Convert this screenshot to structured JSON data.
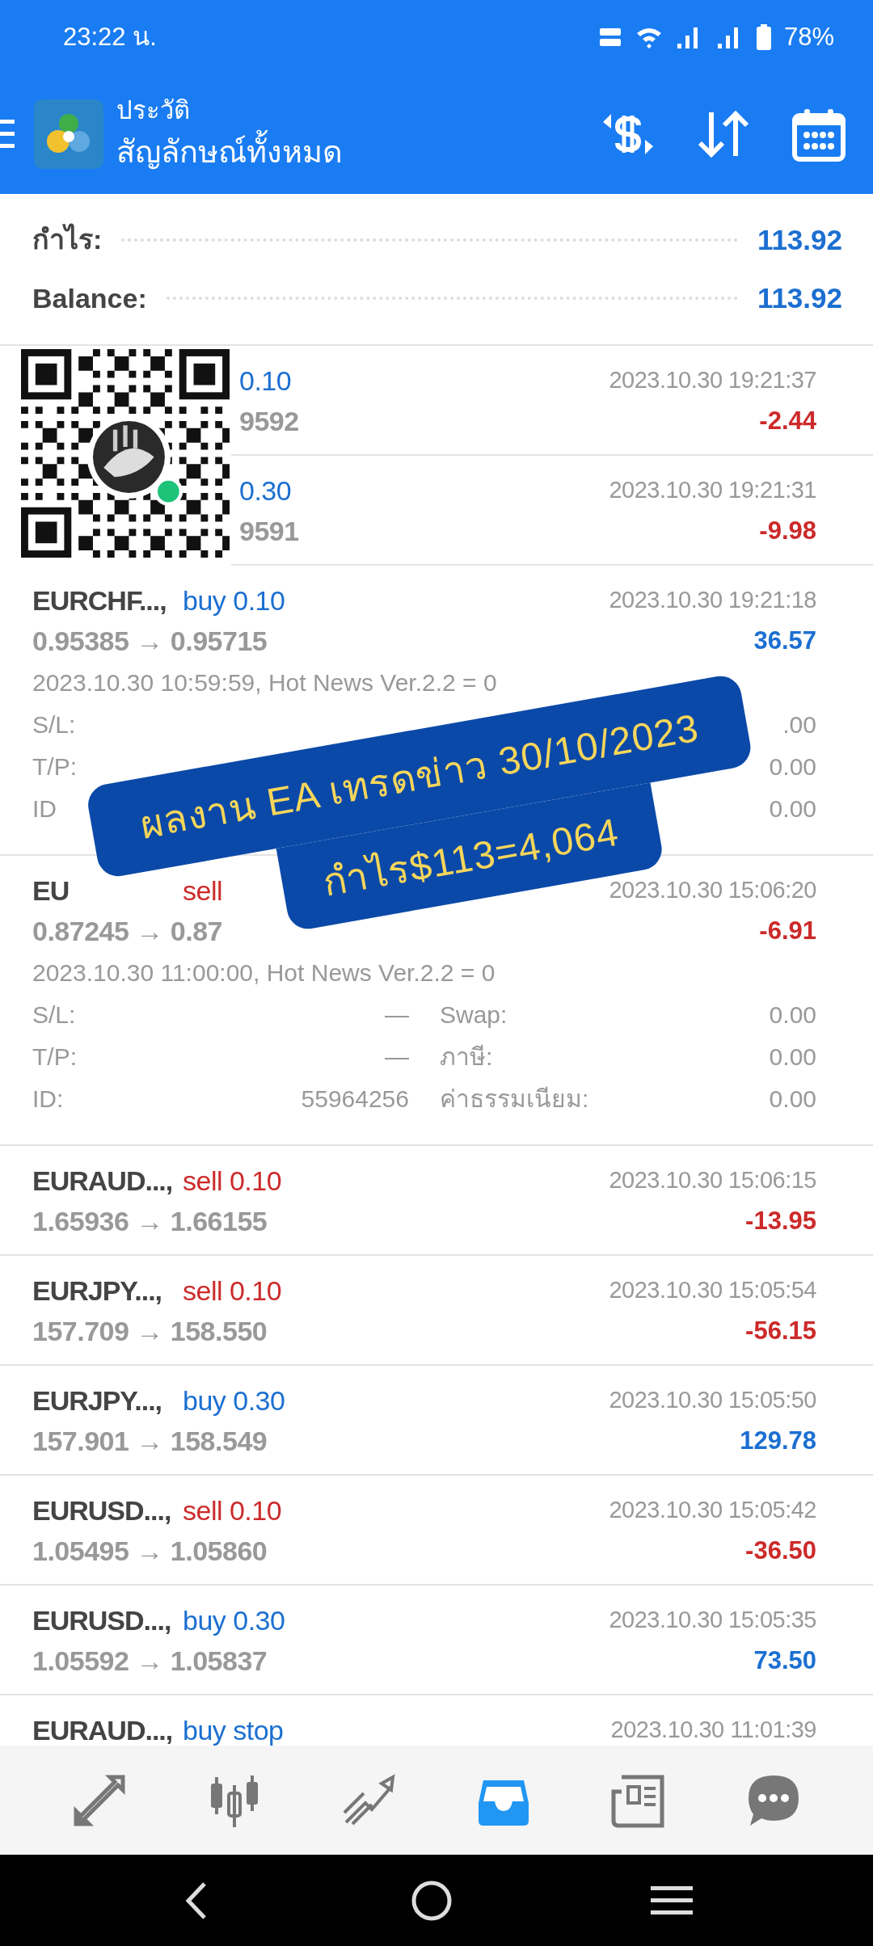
{
  "status_bar": {
    "time": "23:22 น.",
    "battery": "78%"
  },
  "header": {
    "title": "ประวัติ",
    "subtitle": "สัญลักษณ์ทั้งหมด"
  },
  "summary": [
    {
      "label": "กำไร:",
      "value": "113.92"
    },
    {
      "label": "Balance:",
      "value": "113.92"
    }
  ],
  "overlay_rows": [
    {
      "order": "0.10",
      "sell": false,
      "prices": "9592",
      "time": "2023.10.30 19:21:37",
      "profit": "-2.44",
      "loss": true
    },
    {
      "order": "0.30",
      "sell": false,
      "prices": "9591",
      "time": "2023.10.30 19:21:31",
      "profit": "-9.98",
      "loss": true
    }
  ],
  "trades": [
    {
      "symbol": "EURCHF...,",
      "order": "buy 0.10",
      "sell": false,
      "prices": "0.95385 → 0.95715",
      "time": "2023.10.30 19:21:18",
      "profit": "36.57",
      "loss": false,
      "details": {
        "comment": "2023.10.30 10:59:59, Hot News Ver.2.2 = 0",
        "lines": [
          {
            "label": "S/L:",
            "right_value": ".00"
          },
          {
            "label": "T/P:",
            "right_value": "0.00"
          },
          {
            "label": "ID",
            "right_value": "0.00"
          }
        ]
      }
    },
    {
      "symbol": "EU",
      "order": "sell",
      "sell": true,
      "prices": "0.87245 → 0.87",
      "time": "2023.10.30 15:06:20",
      "profit": "-6.91",
      "loss": true,
      "details": {
        "comment": "2023.10.30 11:00:00, Hot News Ver.2.2 = 0",
        "lines": [
          {
            "label": "S/L:",
            "value": "—",
            "right_label": "Swap:",
            "right_value": "0.00"
          },
          {
            "label": "T/P:",
            "value": "—",
            "right_label": "ภาษี:",
            "right_value": "0.00"
          },
          {
            "label": "ID:",
            "value": "55964256",
            "right_label": "ค่าธรรมเนียม:",
            "right_value": "0.00"
          }
        ]
      }
    },
    {
      "symbol": "EURAUD...,",
      "order": "sell 0.10",
      "sell": true,
      "prices": "1.65936 → 1.66155",
      "time": "2023.10.30 15:06:15",
      "profit": "-13.95",
      "loss": true
    },
    {
      "symbol": "EURJPY...,",
      "order": "sell 0.10",
      "sell": true,
      "prices": "157.709 → 158.550",
      "time": "2023.10.30 15:05:54",
      "profit": "-56.15",
      "loss": true
    },
    {
      "symbol": "EURJPY...,",
      "order": "buy 0.30",
      "sell": false,
      "prices": "157.901 → 158.549",
      "time": "2023.10.30 15:05:50",
      "profit": "129.78",
      "loss": false
    },
    {
      "symbol": "EURUSD...,",
      "order": "sell 0.10",
      "sell": true,
      "prices": "1.05495 → 1.05860",
      "time": "2023.10.30 15:05:42",
      "profit": "-36.50",
      "loss": true
    },
    {
      "symbol": "EURUSD...,",
      "order": "buy 0.30",
      "sell": false,
      "prices": "1.05592 → 1.05837",
      "time": "2023.10.30 15:05:35",
      "profit": "73.50",
      "loss": false
    },
    {
      "symbol": "EURAUD...,",
      "order": "buy stop",
      "sell": false,
      "time": "2023.10.30 11:01:39"
    }
  ],
  "banner": {
    "lines": [
      "ผลงาน EA เทรดข่าว 30/10/2023",
      "กำไร$113=4,064"
    ]
  },
  "bottom_nav": [
    {
      "kind": "trade",
      "selected": false
    },
    {
      "kind": "quotes",
      "selected": false
    },
    {
      "kind": "chart",
      "selected": false
    },
    {
      "kind": "history",
      "selected": true
    },
    {
      "kind": "news",
      "selected": false
    },
    {
      "kind": "chat",
      "selected": false
    }
  ]
}
